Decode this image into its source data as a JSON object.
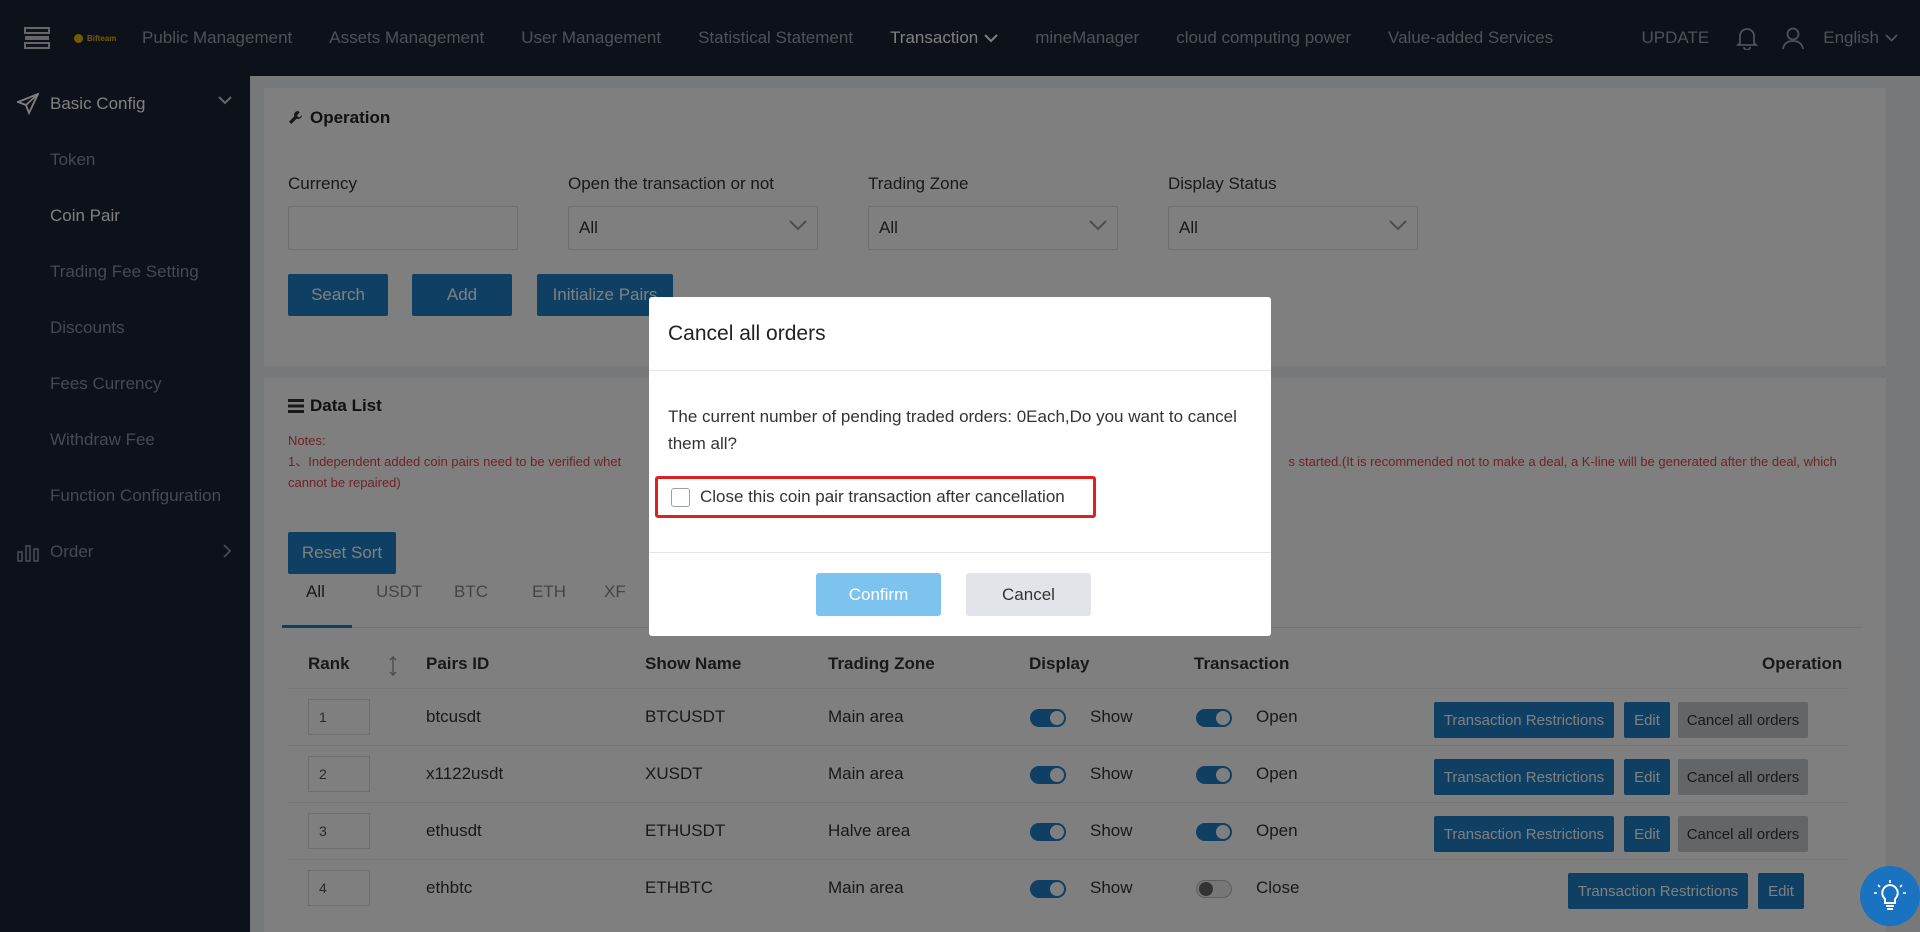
{
  "topnav": {
    "logo_text": "Bifteam",
    "items": [
      "Public Management",
      "Assets Management",
      "User Management",
      "Statistical Statement",
      "Transaction",
      "mineManager",
      "cloud computing power",
      "Value-added Services"
    ],
    "update_label": "UPDATE",
    "language": "English"
  },
  "sidebar": {
    "group1": "Basic Config",
    "items": [
      "Token",
      "Coin Pair",
      "Trading Fee Setting",
      "Discounts",
      "Fees Currency",
      "Withdraw Fee",
      "Function Configuration"
    ],
    "group2": "Order"
  },
  "operation": {
    "title": "Operation",
    "currency_label": "Currency",
    "currency_value": "",
    "open_label": "Open the transaction or not",
    "open_value": "All",
    "zone_label": "Trading Zone",
    "zone_value": "All",
    "display_label": "Display Status",
    "display_value": "All",
    "search_btn": "Search",
    "add_btn": "Add",
    "init_btn": "Initialize Pairs"
  },
  "datalist": {
    "title": "Data List",
    "notes_title": "Notes:",
    "notes_line1_a": "1、Independent added coin pairs need to be verified whet",
    "notes_line1_b": "s started.(It is recommended not to make a deal, a K-line will be generated after the deal, which",
    "notes_line2": "cannot be repaired)",
    "reset_sort": "Reset Sort",
    "tabs": [
      "All",
      "USDT",
      "BTC",
      "ETH",
      "XF"
    ],
    "headers": {
      "rank": "Rank",
      "pairs_id": "Pairs ID",
      "show_name": "Show Name",
      "trading_zone": "Trading Zone",
      "display": "Display",
      "transaction": "Transaction",
      "operation": "Operation"
    },
    "rows": [
      {
        "rank": "1",
        "id": "btcusdt",
        "name": "BTCUSDT",
        "zone": "Main area",
        "display": "Show",
        "transaction": "Open",
        "restrict": "Transaction Restrictions",
        "edit": "Edit",
        "cancel": "Cancel all orders"
      },
      {
        "rank": "2",
        "id": "x1122usdt",
        "name": "XUSDT",
        "zone": "Main area",
        "display": "Show",
        "transaction": "Open",
        "restrict": "Transaction Restrictions",
        "edit": "Edit",
        "cancel": "Cancel all orders"
      },
      {
        "rank": "3",
        "id": "ethusdt",
        "name": "ETHUSDT",
        "zone": "Halve area",
        "display": "Show",
        "transaction": "Open",
        "restrict": "Transaction Restrictions",
        "edit": "Edit",
        "cancel": "Cancel all orders"
      },
      {
        "rank": "4",
        "id": "ethbtc",
        "name": "ETHBTC",
        "zone": "Main area",
        "display": "Show",
        "transaction": "Close",
        "restrict": "Transaction Restrictions",
        "edit": "Edit"
      }
    ]
  },
  "modal": {
    "title": "Cancel all orders",
    "message": "The current number of pending traded orders: 0Each,Do you want to cancel them all?",
    "checkbox_label": "Close this coin pair transaction after cancellation",
    "checkbox_checked": false,
    "confirm": "Confirm",
    "cancel": "Cancel"
  },
  "colors": {
    "accent": "#1e80c8",
    "nav_bg": "#1b2233",
    "highlight": "#e02020",
    "notes": "#e0464e"
  }
}
